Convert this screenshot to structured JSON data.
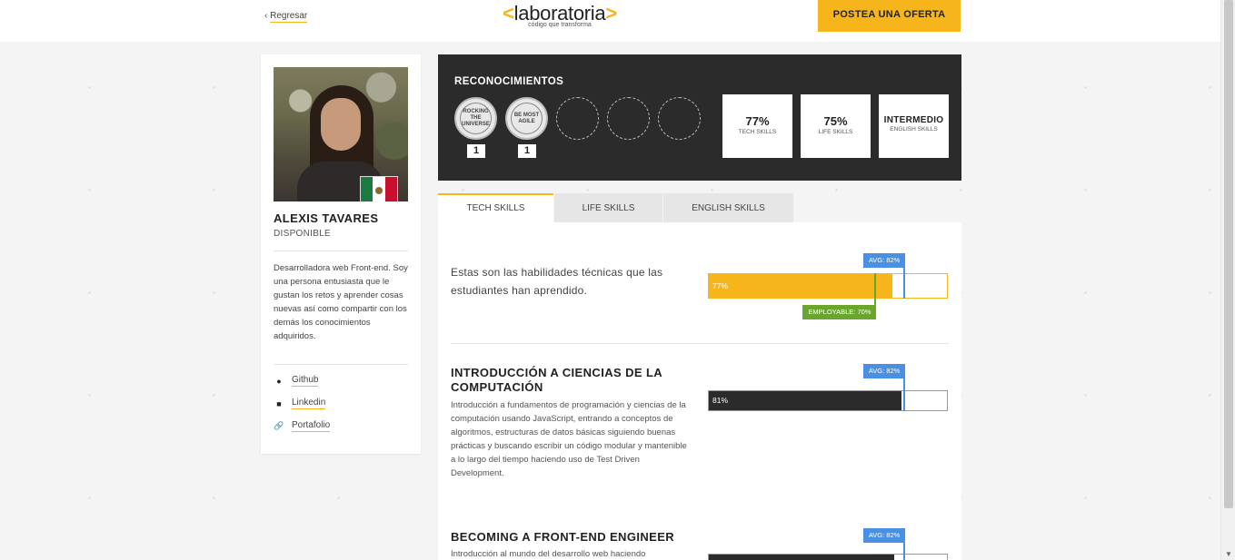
{
  "header": {
    "back_label": "Regresar",
    "back_chevron": "‹",
    "logo_left_bracket": "<",
    "logo_word": "laboratoria",
    "logo_right_bracket": ">",
    "logo_tagline": "código que transforma",
    "post_offer_label": "POSTEA UNA OFERTA"
  },
  "colors": {
    "accent": "#f7b51c",
    "dark": "#2b2b2b",
    "avg": "#4a90e2",
    "employable": "#6aa52d"
  },
  "profile": {
    "name": "ALEXIS TAVARES",
    "status": "DISPONIBLE",
    "bio": "Desarrolladora web Front-end. Soy una persona entusiasta que le gustan los retos y aprender cosas nuevas así como compartir con los demás los conocimientos adquiridos.",
    "links": [
      {
        "icon": "github-icon",
        "label": "Github"
      },
      {
        "icon": "linkedin-icon",
        "label": "Linkedin"
      },
      {
        "icon": "link-icon",
        "label": "Portafolio"
      }
    ]
  },
  "recognitions": {
    "title": "RECONOCIMIENTOS",
    "badges": [
      {
        "name": "rocking-the-universe-badge-icon",
        "count": "1"
      },
      {
        "name": "be-agile-badge-icon",
        "count": "1"
      }
    ],
    "scores": [
      {
        "value": "77%",
        "label": "TECH SKILLS"
      },
      {
        "value": "75%",
        "label": "LIFE SKILLS"
      },
      {
        "value": "INTERMEDIO",
        "label": "ENGLISH SKILLS"
      }
    ]
  },
  "tabs": [
    {
      "label": "TECH SKILLS",
      "active": true
    },
    {
      "label": "LIFE SKILLS",
      "active": false
    },
    {
      "label": "ENGLISH SKILLS",
      "active": false
    }
  ],
  "summary": {
    "text": "Estas son las habilidades técnicas que las estudiantes han aprendido.",
    "score_label": "77%",
    "score": 77,
    "avg_label": "AVG: 82%",
    "avg": 82,
    "employable_label": "EMPLOYABLE: 70%",
    "employable": 70
  },
  "sections": [
    {
      "title": "INTRODUCCIÓN A CIENCIAS DE LA COMPUTACIÓN",
      "desc": "Introducción a fundamentos de programación y ciencias de la computación usando JavaScript, entrando a conceptos de algoritmos, estructuras de datos básicas siguiendo buenas prácticas y buscando escribir un código modular y mantenible a lo largo del tiempo haciendo uso de Test Driven Development.",
      "score_label": "81%",
      "score": 81,
      "avg_label": "AVG: 82%",
      "avg": 82
    },
    {
      "title": "BECOMING A FRONT-END ENGINEER",
      "desc": "Introducción al mundo del desarrollo web haciendo",
      "score": 78,
      "avg_label": "AVG: 82%",
      "avg": 82
    }
  ]
}
